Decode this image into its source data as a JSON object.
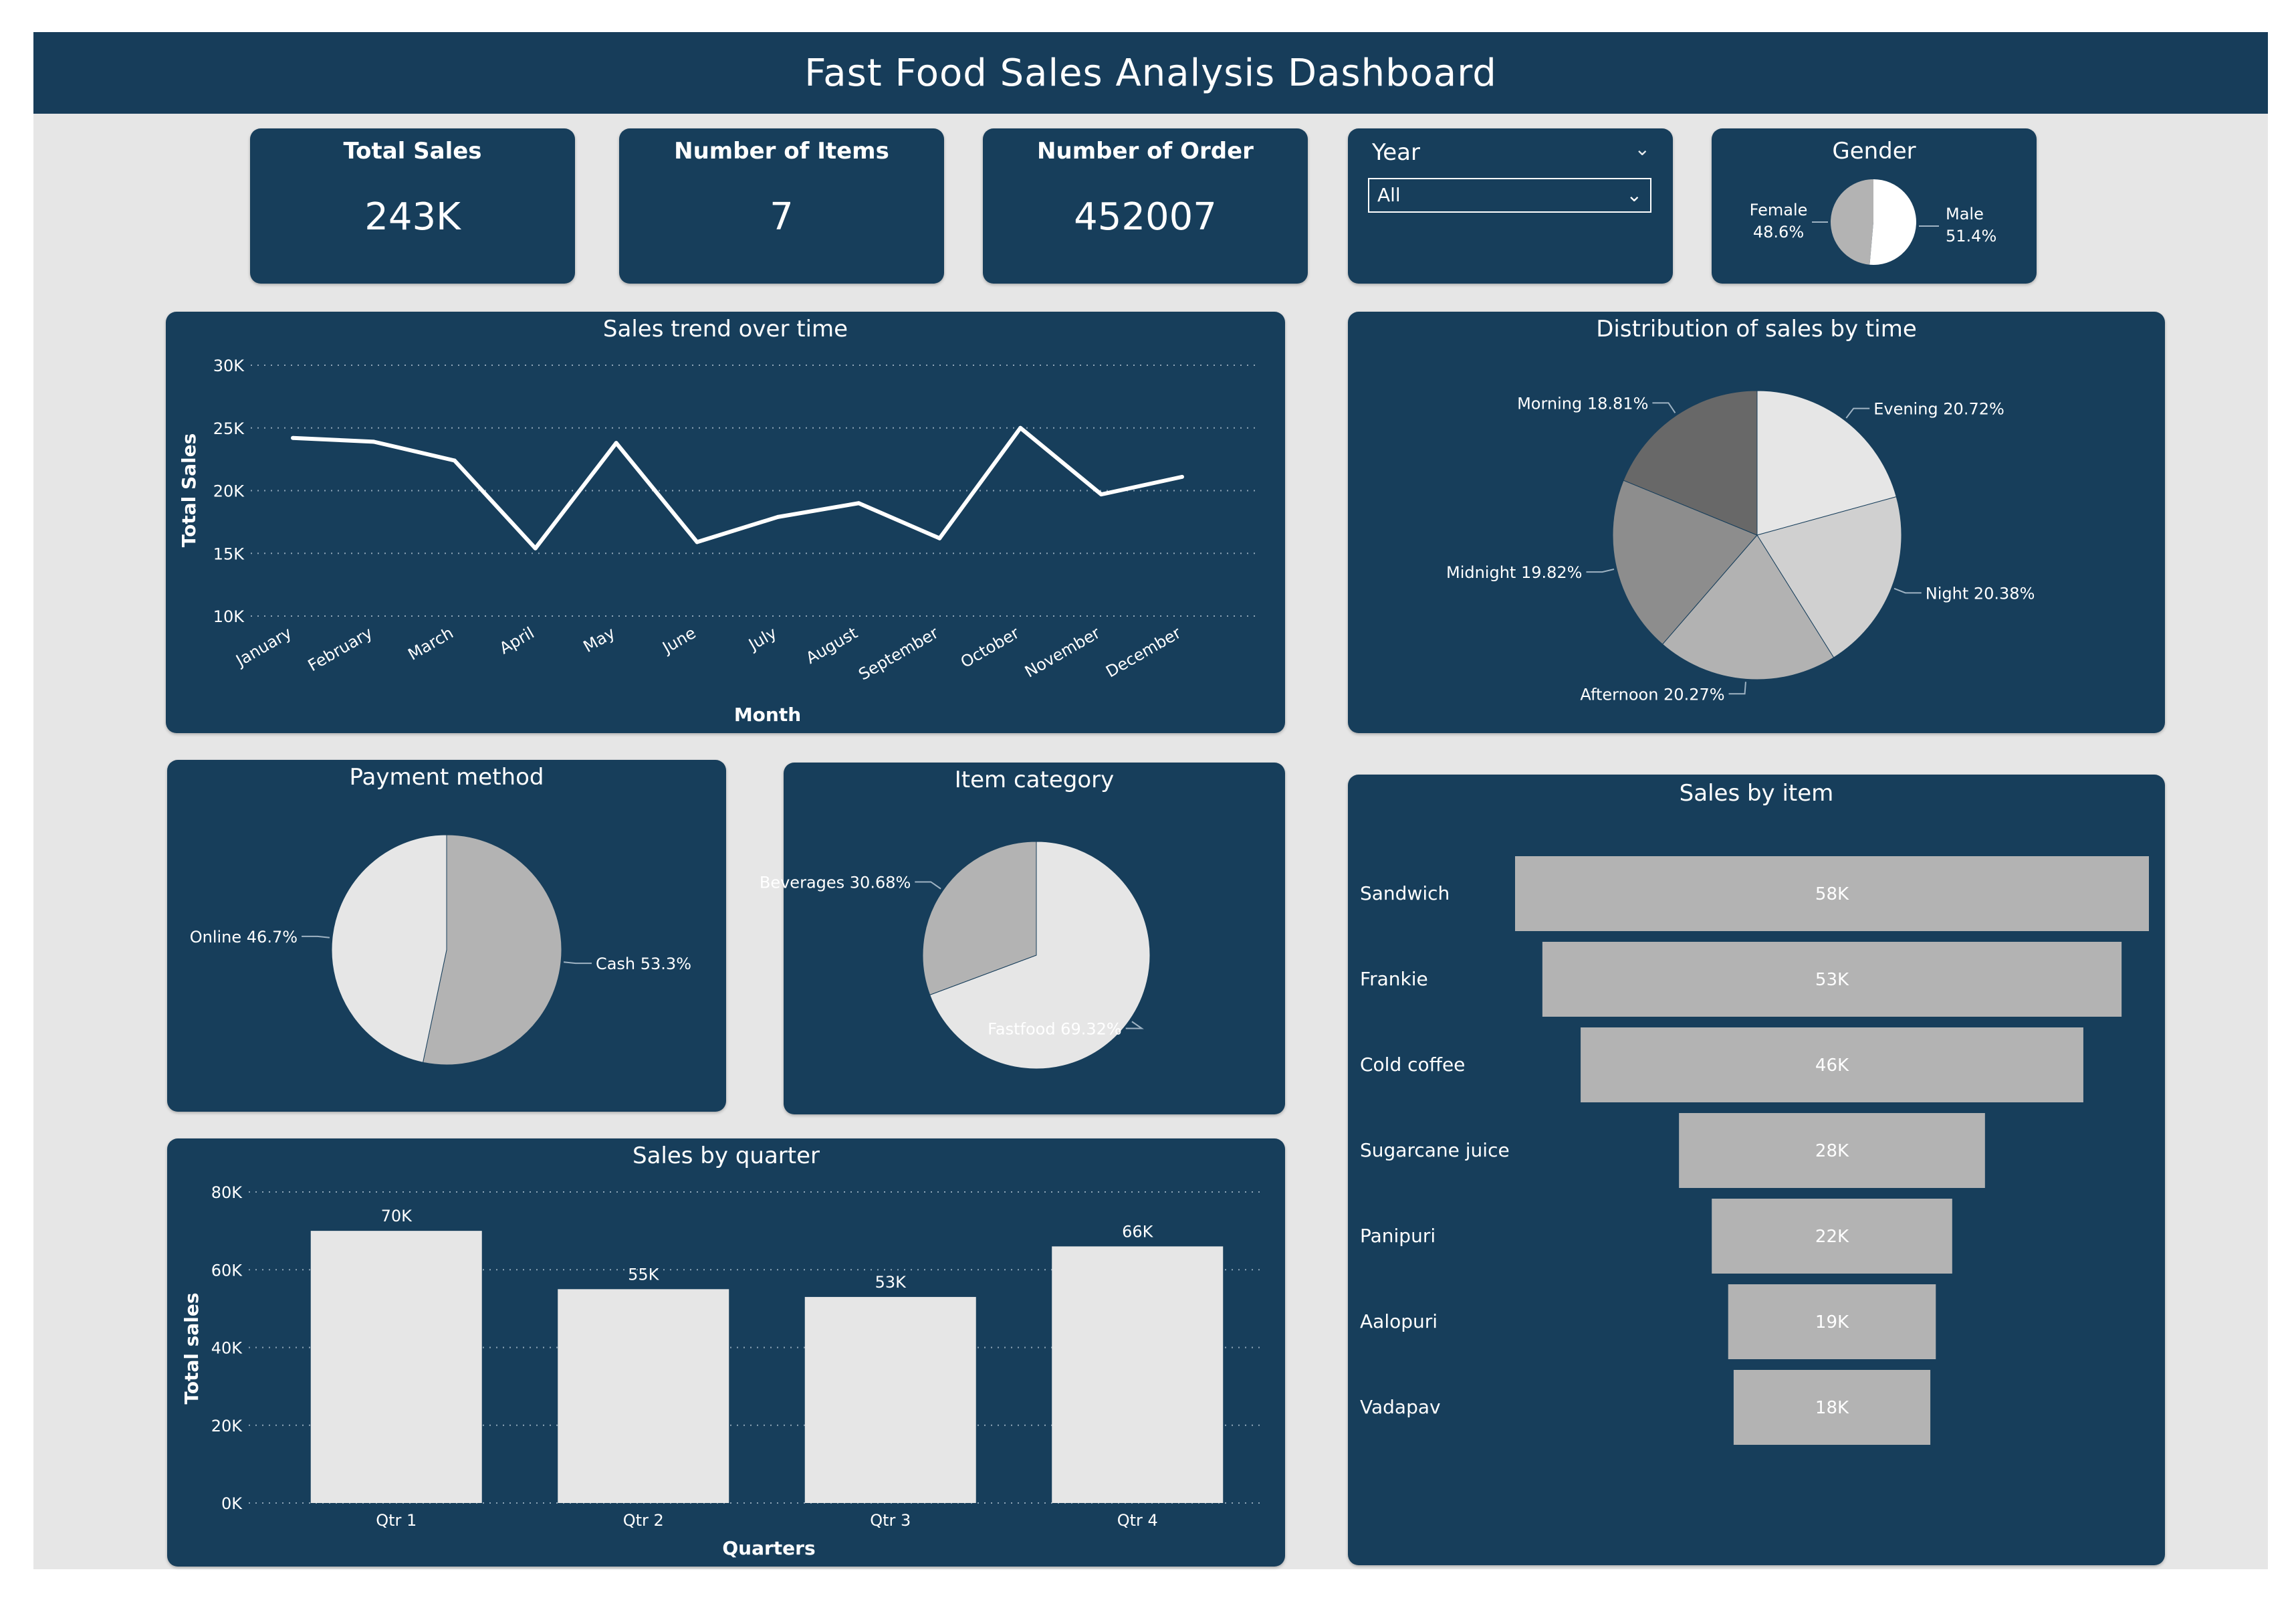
{
  "dashboard": {
    "title": "Fast Food Sales Analysis Dashboard",
    "colors": {
      "background": "#e6e6e6",
      "header": "#173d5a",
      "panel": "#173e5b",
      "line": "#ffffff",
      "bar_light": "#e6e6e6",
      "bar_grey": "#b3b3b3"
    }
  },
  "kpis": [
    {
      "title": "Total Sales",
      "value": "243K"
    },
    {
      "title": "Number of Items",
      "value": "7"
    },
    {
      "title": "Number of Order",
      "value": "452007"
    }
  ],
  "year_slicer": {
    "label": "Year",
    "selected": "All",
    "icon": "chevron-down-icon"
  },
  "gender": {
    "title": "Gender",
    "female_label": "Female",
    "female_pct": "48.6%",
    "male_label": "Male",
    "male_pct": "51.4%"
  },
  "chart_data": [
    {
      "id": "trend",
      "type": "line",
      "title": "Sales trend over time",
      "xlabel": "Month",
      "ylabel": "Total Sales",
      "categories": [
        "January",
        "February",
        "March",
        "April",
        "May",
        "June",
        "July",
        "August",
        "September",
        "October",
        "November",
        "December"
      ],
      "values": [
        24200,
        23900,
        22400,
        15400,
        23800,
        15900,
        17900,
        19000,
        16200,
        25000,
        19700,
        21100
      ],
      "ylim": [
        10000,
        30000
      ],
      "yticks": [
        10000,
        15000,
        20000,
        25000,
        30000
      ],
      "ytick_labels": [
        "10K",
        "15K",
        "20K",
        "25K",
        "30K"
      ],
      "grid": true
    },
    {
      "id": "time",
      "type": "pie",
      "title": "Distribution of sales by time",
      "slices": [
        {
          "label": "Evening",
          "value": 20.72,
          "display": "Evening 20.72%",
          "color": "#e6e6e6"
        },
        {
          "label": "Night",
          "value": 20.38,
          "display": "Night 20.38%",
          "color": "#d0d0d0"
        },
        {
          "label": "Afternoon",
          "value": 20.27,
          "display": "Afternoon 20.27%",
          "color": "#b2b2b2"
        },
        {
          "label": "Midnight",
          "value": 19.82,
          "display": "Midnight 19.82%",
          "color": "#8d8d8d"
        },
        {
          "label": "Morning",
          "value": 18.81,
          "display": "Morning 18.81%",
          "color": "#686868"
        }
      ]
    },
    {
      "id": "payment",
      "type": "pie",
      "title": "Payment method",
      "slices": [
        {
          "label": "Cash",
          "value": 53.3,
          "display": "Cash 53.3%",
          "color": "#b3b3b3"
        },
        {
          "label": "Online",
          "value": 46.7,
          "display": "Online 46.7%",
          "color": "#e6e6e6"
        }
      ]
    },
    {
      "id": "category",
      "type": "pie",
      "title": "Item category",
      "slices": [
        {
          "label": "Fastfood",
          "value": 69.32,
          "display": "Fastfood 69.32%",
          "color": "#e6e6e6"
        },
        {
          "label": "Beverages",
          "value": 30.68,
          "display": "Beverages 30.68%",
          "color": "#b3b3b3"
        }
      ]
    },
    {
      "id": "quarter",
      "type": "bar",
      "title": "Sales by quarter",
      "xlabel": "Quarters",
      "ylabel": "Total sales",
      "categories": [
        "Qtr 1",
        "Qtr 2",
        "Qtr 3",
        "Qtr 4"
      ],
      "values": [
        70000,
        55000,
        53000,
        66000
      ],
      "value_labels": [
        "70K",
        "55K",
        "53K",
        "66K"
      ],
      "ylim": [
        0,
        80000
      ],
      "yticks": [
        0,
        20000,
        40000,
        60000,
        80000
      ],
      "ytick_labels": [
        "0K",
        "20K",
        "40K",
        "60K",
        "80K"
      ],
      "grid": true
    },
    {
      "id": "items",
      "type": "bar",
      "orientation": "horizontal-funnel",
      "title": "Sales by item",
      "categories": [
        "Sandwich",
        "Frankie",
        "Cold coffee",
        "Sugarcane juice",
        "Panipuri",
        "Aalopuri",
        "Vadapav"
      ],
      "values": [
        58000,
        53000,
        46000,
        28000,
        22000,
        19000,
        18000
      ],
      "value_labels": [
        "58K",
        "53K",
        "46K",
        "28K",
        "22K",
        "19K",
        "18K"
      ]
    }
  ]
}
